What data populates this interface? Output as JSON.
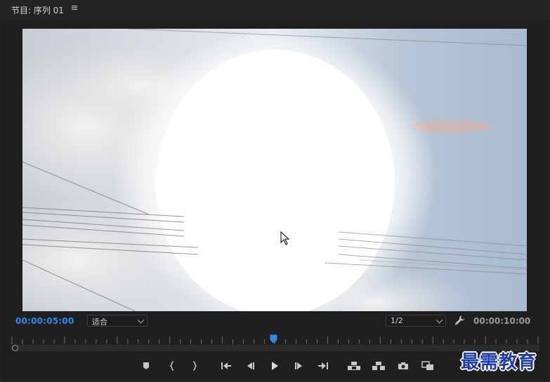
{
  "panel": {
    "title": "节目: 序列 01",
    "menu_glyph": "≡"
  },
  "viewer": {
    "content": "sky-with-sun-glare-and-power-lines"
  },
  "timecode": {
    "current": "00:00:05:00",
    "duration": "00:00:10:00"
  },
  "zoom": {
    "selected": "适合"
  },
  "resolution": {
    "selected": "1/2"
  },
  "playhead": {
    "fraction": 0.498
  },
  "transport": {
    "buttons": [
      {
        "name": "add-marker-button",
        "icon": "marker-icon"
      },
      {
        "name": "mark-in-button",
        "icon": "mark-in-icon"
      },
      {
        "name": "mark-out-button",
        "icon": "mark-out-icon"
      },
      {
        "name": "go-to-in-button",
        "icon": "go-to-in-icon"
      },
      {
        "name": "step-back-button",
        "icon": "step-back-icon"
      },
      {
        "name": "play-button",
        "icon": "play-icon"
      },
      {
        "name": "step-forward-button",
        "icon": "step-forward-icon"
      },
      {
        "name": "go-to-out-button",
        "icon": "go-to-out-icon"
      },
      {
        "name": "lift-button",
        "icon": "lift-icon"
      },
      {
        "name": "extract-button",
        "icon": "extract-icon"
      },
      {
        "name": "export-frame-button",
        "icon": "camera-icon"
      },
      {
        "name": "comparison-view-button",
        "icon": "comparison-view-icon"
      }
    ]
  },
  "watermark": {
    "text": "最需教育"
  },
  "colors": {
    "accent": "#2d8ceb",
    "background": "#232323"
  }
}
